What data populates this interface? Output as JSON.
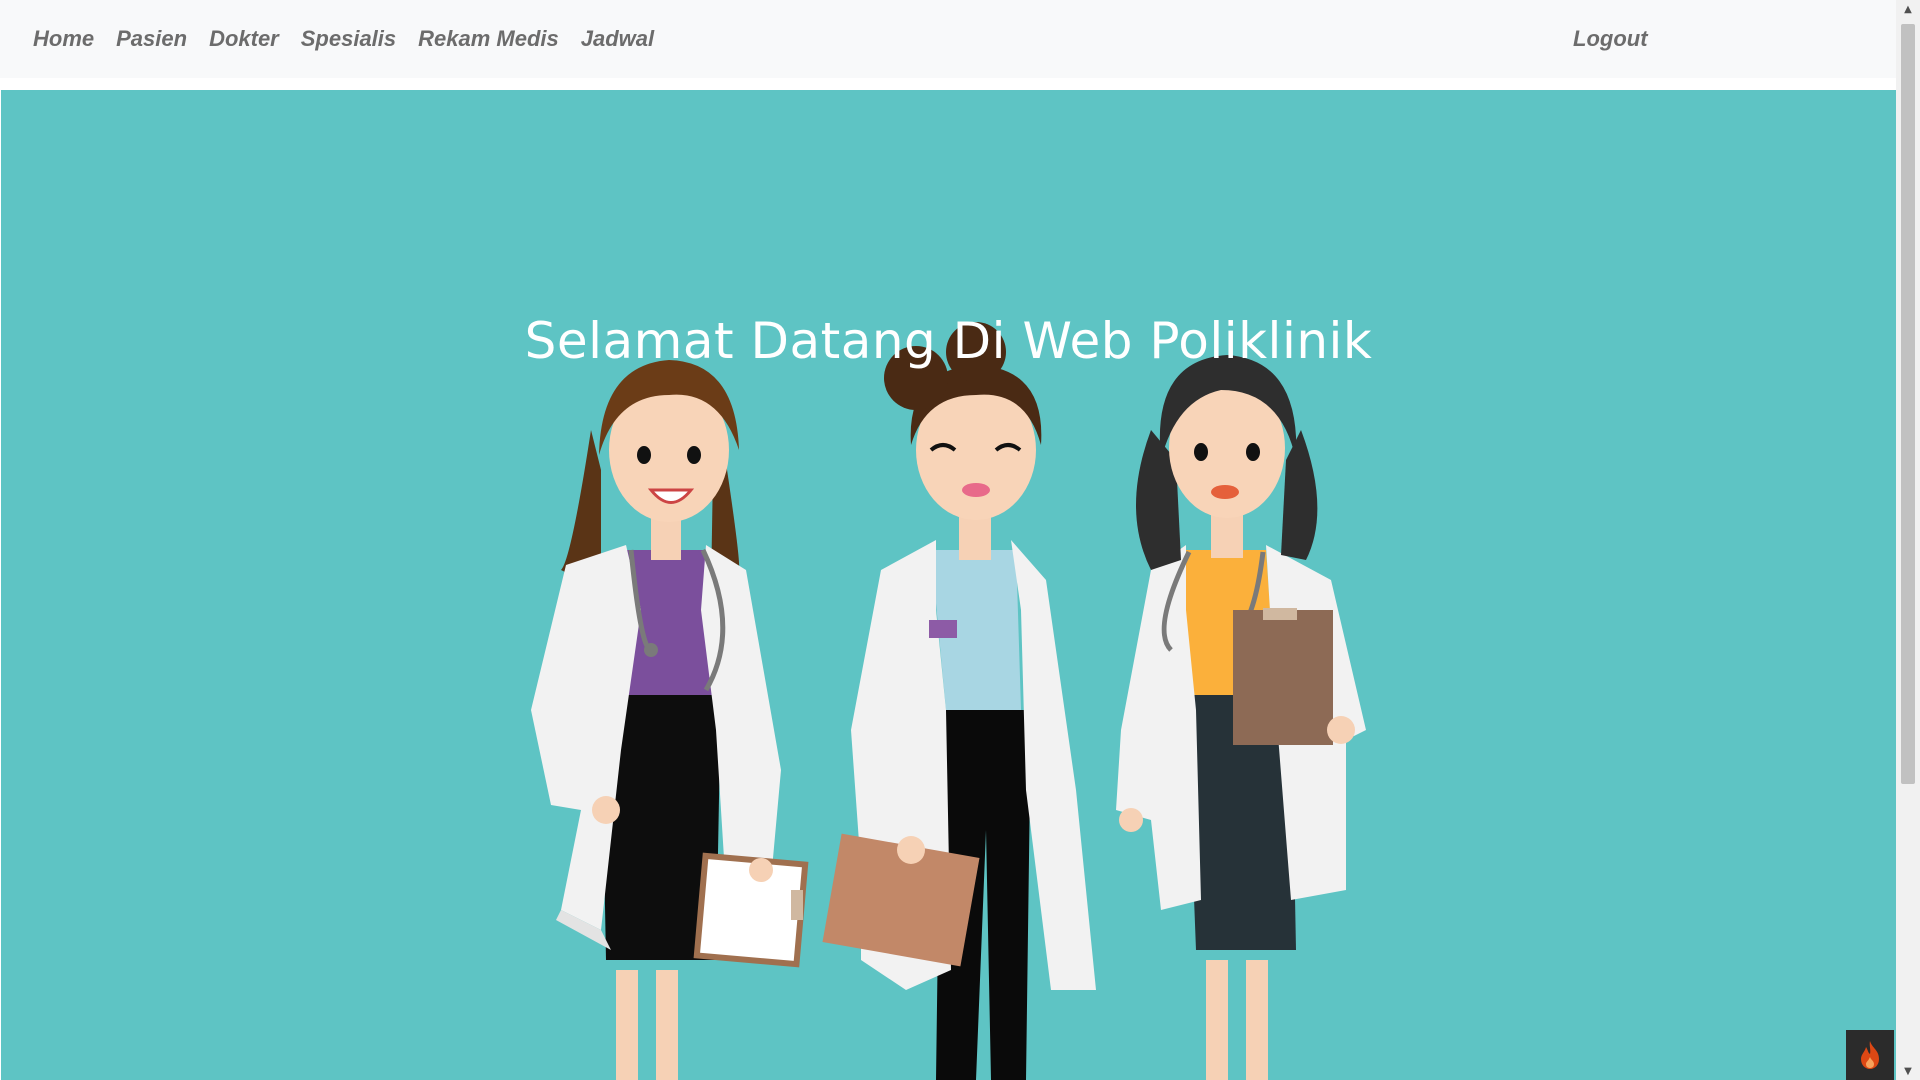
{
  "nav": {
    "left_items": [
      {
        "label": "Home"
      },
      {
        "label": "Pasien"
      },
      {
        "label": "Dokter"
      },
      {
        "label": "Spesialis"
      },
      {
        "label": "Rekam Medis"
      },
      {
        "label": "Jadwal"
      }
    ],
    "logout_label": "Logout"
  },
  "hero": {
    "title": "Selamat Datang Di Web Poliklinik"
  },
  "colors": {
    "hero_background": "#5ec4c4",
    "navbar_background": "#f8f9fa",
    "nav_text": "#6c6c6c"
  },
  "icons": {
    "debug_badge": "flame-icon"
  }
}
